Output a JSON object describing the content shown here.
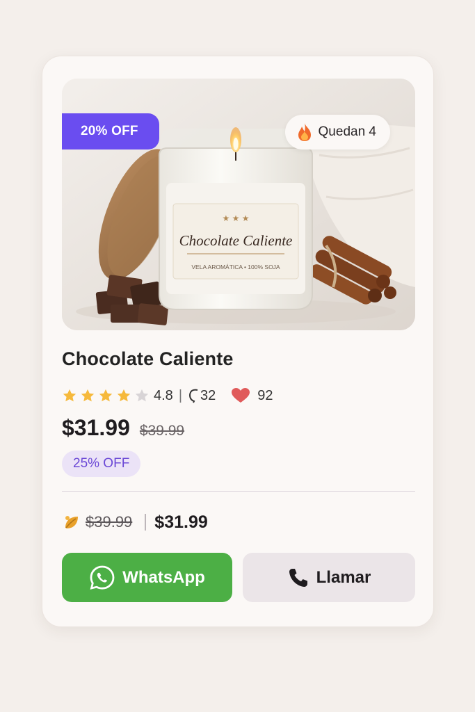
{
  "product": {
    "title": "Chocolate Caliente",
    "discount_tab": "20% OFF",
    "stock_label": "Quedan 4",
    "image_label_title": "Chocolate Caliente",
    "image_label_sub": "VELA AROMÁTICA • 100% SOJA",
    "rating": "4.8",
    "rating_stars": 4,
    "reviews": "32",
    "likes": "92",
    "price": "$31.99",
    "old_price": "$39.99",
    "off_badge": "25% OFF",
    "bundle_old_price": "$39.99",
    "bundle_price": "$31.99"
  },
  "buttons": {
    "whatsapp_label": "WhatsApp",
    "call_label": "Llamar"
  },
  "colors": {
    "accent_purple": "#6a4df0",
    "whatsapp_green": "#4caf45",
    "star_gold": "#f6b93b",
    "heart_red": "#e05a5a"
  },
  "icons": {
    "stock": "flame-icon",
    "comments": "comment-icon",
    "likes": "heart-icon",
    "bundle": "leaf-icon",
    "whatsapp": "whatsapp-icon",
    "call": "phone-icon"
  }
}
